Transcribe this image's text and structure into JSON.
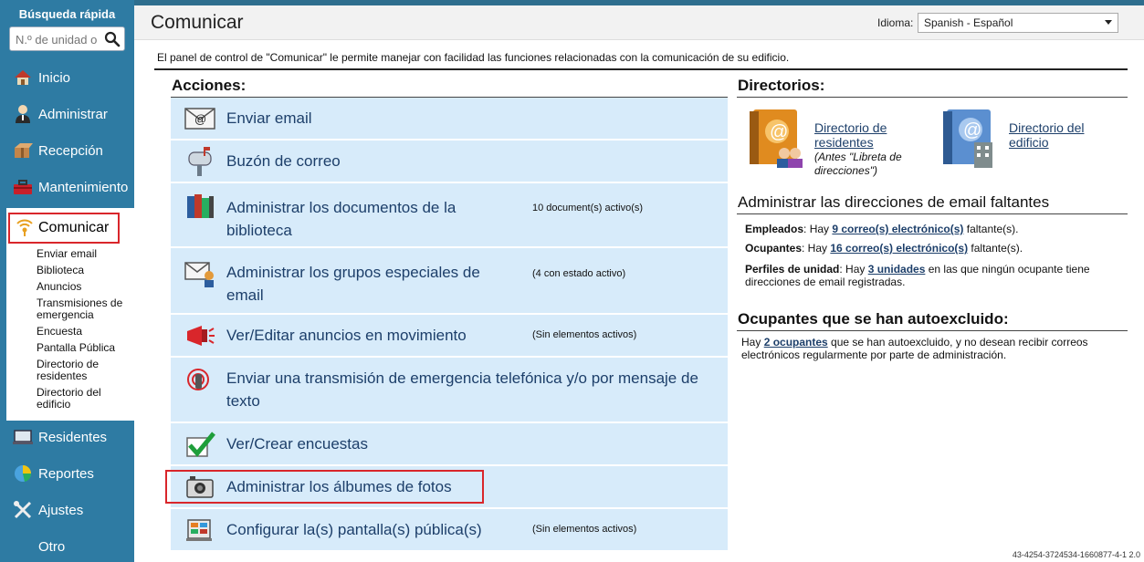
{
  "sidebar": {
    "quick_search_title": "Búsqueda rápida",
    "quick_search_placeholder": "N.º de unidad o",
    "items": [
      {
        "label": "Inicio",
        "icon": "home-icon"
      },
      {
        "label": "Administrar",
        "icon": "admin-user-icon"
      },
      {
        "label": "Recepción",
        "icon": "package-icon"
      },
      {
        "label": "Mantenimiento",
        "icon": "toolbox-icon"
      },
      {
        "label": "Comunicar",
        "icon": "broadcast-icon"
      },
      {
        "label": "Residentes",
        "icon": "residents-icon"
      },
      {
        "label": "Reportes",
        "icon": "pie-chart-icon"
      },
      {
        "label": "Ajustes",
        "icon": "tools-icon"
      },
      {
        "label": "Otro",
        "icon": ""
      }
    ],
    "subitems": [
      "Enviar email",
      "Biblioteca",
      "Anuncios",
      "Transmisiones de emergencia",
      "Encuesta",
      "Pantalla Pública",
      "Directorio de residentes",
      "Directorio del edificio"
    ]
  },
  "header": {
    "title": "Comunicar",
    "language_label": "Idioma:",
    "language_value": "Spanish - Español"
  },
  "intro": "El panel de control de \"Comunicar\" le permite manejar con facilidad las funciones relacionadas con la comunicación de su edificio.",
  "actions": {
    "heading": "Acciones:",
    "items": [
      {
        "label": "Enviar email",
        "status": "",
        "icon": "email-icon"
      },
      {
        "label": "Buzón de correo",
        "status": "",
        "icon": "mailbox-icon"
      },
      {
        "label": "Administrar los documentos de la biblioteca",
        "status": "10 document(s) activo(s)",
        "icon": "library-books-icon"
      },
      {
        "label": "Administrar los grupos especiales de email",
        "status": "(4 con estado activo)",
        "icon": "group-email-icon"
      },
      {
        "label": "Ver/Editar anuncios en movimiento",
        "status": "(Sin elementos activos)",
        "icon": "megaphone-icon"
      },
      {
        "label": "Enviar una transmisión de emergencia telefónica y/o por mensaje de texto",
        "status": "",
        "icon": "emergency-phone-icon"
      },
      {
        "label": "Ver/Crear encuestas",
        "status": "",
        "icon": "checkmark-icon"
      },
      {
        "label": "Administrar los álbumes de fotos",
        "status": "",
        "icon": "camera-icon"
      },
      {
        "label": "Configurar la(s) pantalla(s) pública(s)",
        "status": "(Sin elementos activos)",
        "icon": "public-screen-icon"
      }
    ]
  },
  "directories": {
    "heading": "Directorios:",
    "residents_link_1": "Directorio de",
    "residents_link_2": "residentes",
    "residents_note_1": "(Antes \"Libreta de",
    "residents_note_2": "direcciones\")",
    "building_link_1": "Directorio del",
    "building_link_2": "edificio"
  },
  "missing_email": {
    "heading": "Administrar las direcciones de email faltantes",
    "employees_label": "Empleados",
    "employees_pre": ": Hay ",
    "employees_link": "9 correo(s) electrónico(s)",
    "employees_post": " faltante(s).",
    "occupants_label": "Ocupantes",
    "occupants_pre": ": Hay ",
    "occupants_link": "16 correo(s) electrónico(s)",
    "occupants_post": " faltante(s).",
    "profiles_label": "Perfiles de unidad",
    "profiles_pre": ": Hay ",
    "profiles_link": "3 unidades",
    "profiles_post_1": " en las que ningún ocupante tiene",
    "profiles_post_2": "direcciones de email registradas."
  },
  "optout": {
    "heading": "Ocupantes que se han autoexcluido:",
    "pre": "Hay ",
    "link": "2 ocupantes",
    "post_1": " que se han autoexcluido, y no desean recibir correos",
    "post_2": "electrónicos regularmente por parte de administración."
  },
  "footer_code": "43-4254-3724534-1660877-4-1 2.0",
  "colors": {
    "sidebar": "#2e7ba3",
    "action_bg": "#d7ebfa",
    "link": "#1d3f6a",
    "highlight": "#d9262b"
  }
}
